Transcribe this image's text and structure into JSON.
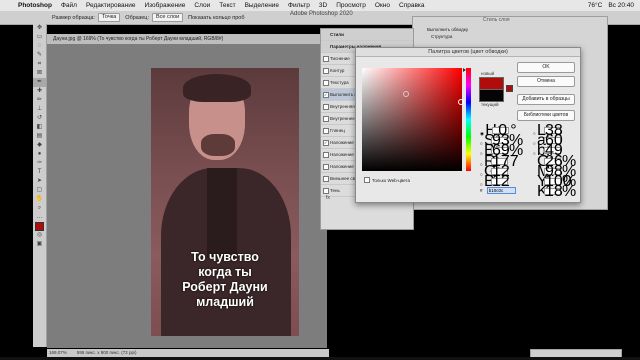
{
  "menubar": {
    "app": "Photoshop",
    "items": [
      "Файл",
      "Редактирование",
      "Изображение",
      "Слои",
      "Текст",
      "Выделение",
      "Фильтр",
      "3D",
      "Просмотр",
      "Окно",
      "Справка"
    ],
    "temp": "76°C",
    "time": "Вс 20:40"
  },
  "options": {
    "sample_label": "Размер образца:",
    "sample_value": "Точка",
    "sample_from_label": "Образец:",
    "sample_from_value": "Все слои",
    "show_ring": "Показать кольцо проб",
    "window_title": "Adobe Photoshop 2020"
  },
  "document": {
    "tab": "Дауни.jpg @ 169% (То чувство  когда ты  Роберт Дауни младший, RGB/8#)",
    "meme_lines": [
      "То чувство",
      "когда ты",
      "Роберт Дауни",
      "младший"
    ]
  },
  "layer_style": {
    "header1": "Стили",
    "header2": "Параметры наложения",
    "items": [
      "Тиснение",
      "Контур",
      "Текстура",
      "Выполнить обводку",
      "Внутренняя тень",
      "Внутреннее свечение",
      "Глянец",
      "Наложение цвета",
      "Наложение градиента",
      "Наложение узора",
      "Внешнее свечение",
      "Тень"
    ],
    "checked": [
      false,
      false,
      false,
      true,
      false,
      false,
      false,
      true,
      false,
      false,
      false,
      false
    ],
    "fx_label": "fx"
  },
  "rightpanel": {
    "title": "Стиль слоя",
    "sec1": "Выполнить обводку",
    "sec2": "Структура"
  },
  "picker": {
    "title": "Палитра цветов (цвет обводки)",
    "ok": "OK",
    "cancel": "Отмена",
    "add_swatch": "Добавить в образцы",
    "libraries": "Библиотеки цветов",
    "new_label": "новый",
    "current_label": "текущий",
    "web_only": "Только Web-цвета",
    "new_color": "#b10c0c",
    "current_color": "#050505",
    "hsb": [
      {
        "k": "H:",
        "v": "0",
        "u": "°"
      },
      {
        "k": "S:",
        "v": "93",
        "u": "%"
      },
      {
        "k": "B:",
        "v": "69",
        "u": "%"
      }
    ],
    "rgb": [
      {
        "k": "R:",
        "v": "177",
        "u": ""
      },
      {
        "k": "G:",
        "v": "12",
        "u": ""
      },
      {
        "k": "B:",
        "v": "12",
        "u": ""
      }
    ],
    "lab": [
      {
        "k": "L:",
        "v": "38",
        "u": ""
      },
      {
        "k": "a:",
        "v": "60",
        "u": ""
      },
      {
        "k": "b:",
        "v": "49",
        "u": ""
      }
    ],
    "cmyk": [
      {
        "k": "C:",
        "v": "26",
        "u": "%"
      },
      {
        "k": "M:",
        "v": "98",
        "u": "%"
      },
      {
        "k": "Y:",
        "v": "100",
        "u": "%"
      },
      {
        "k": "K:",
        "v": "18",
        "u": "%"
      }
    ],
    "hex_label": "#",
    "hex": "b10c0c"
  },
  "status": {
    "zoom": "169,07%",
    "size": "595 пикс. x 900 пикс. (72 ppi)"
  }
}
